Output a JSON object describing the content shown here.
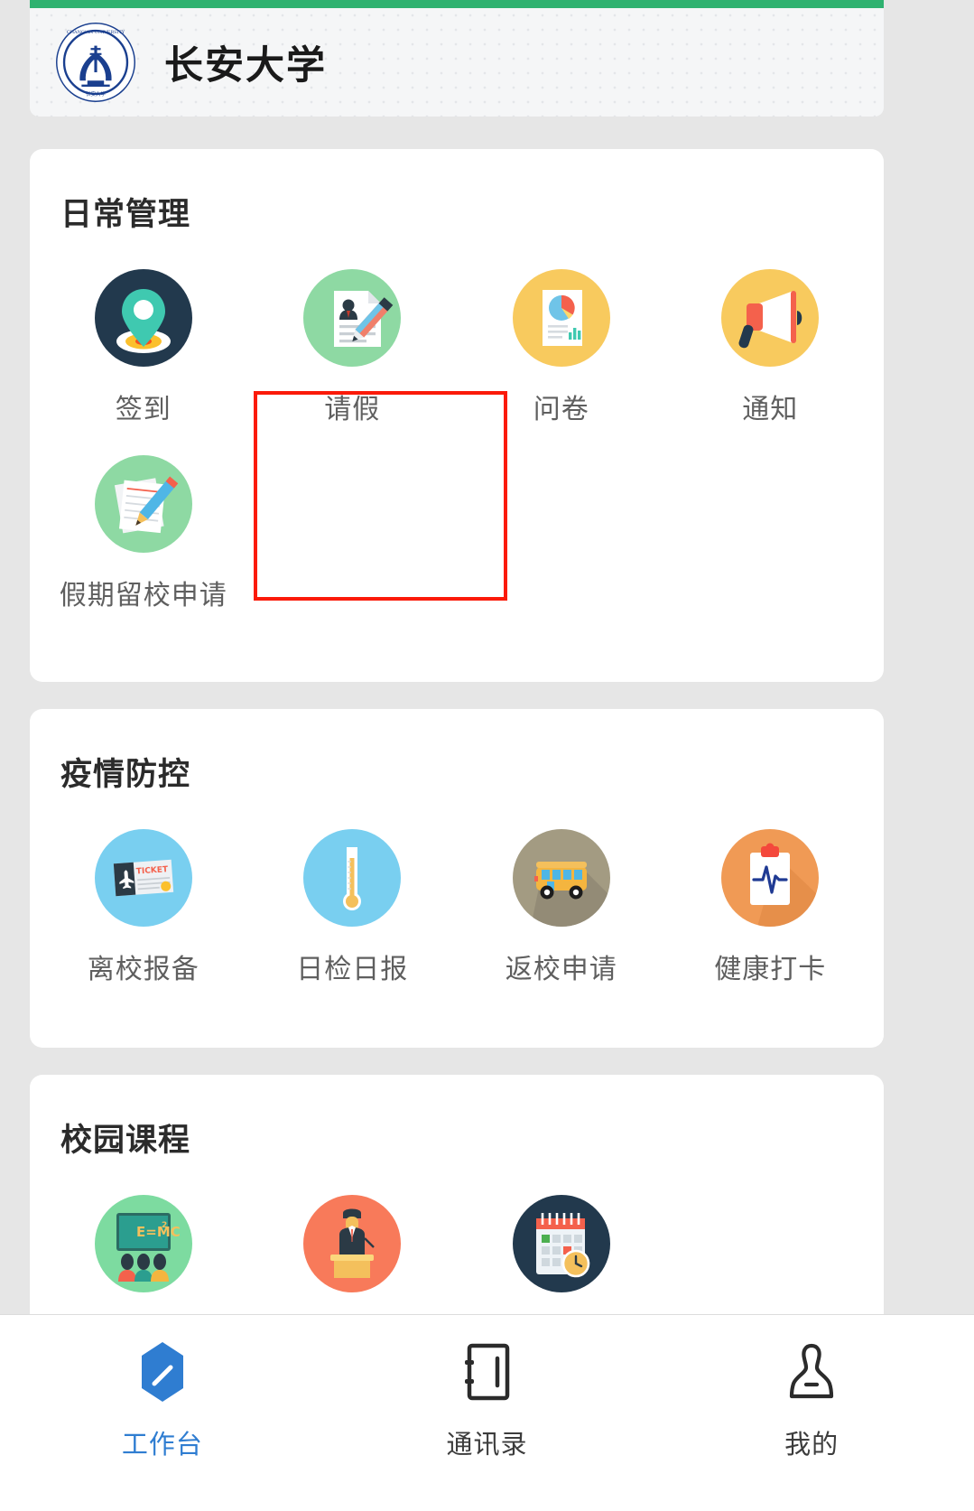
{
  "app": {
    "university_name": "长安大学",
    "logo_text": "CHANG'AN UNIVERSITY",
    "accent_green": "#2fb270",
    "highlight_color": "#fb1a09",
    "active_tab_color": "#2f7dd1"
  },
  "sections": [
    {
      "title": "日常管理",
      "items": [
        {
          "label": "签到",
          "icon": "location-pin-icon",
          "circle_color": "#22394d"
        },
        {
          "label": "请假",
          "icon": "leave-document-icon",
          "circle_color": "#8ed9a3",
          "highlighted": true
        },
        {
          "label": "问卷",
          "icon": "survey-chart-icon",
          "circle_color": "#f8ca5e"
        },
        {
          "label": "通知",
          "icon": "megaphone-icon",
          "circle_color": "#f8ca5e"
        },
        {
          "label": "假期留校申请",
          "icon": "notes-pencil-icon",
          "circle_color": "#8ed9a3"
        }
      ]
    },
    {
      "title": "疫情防控",
      "items": [
        {
          "label": "离校报备",
          "icon": "plane-ticket-icon",
          "circle_color": "#79cff0"
        },
        {
          "label": "日检日报",
          "icon": "thermometer-icon",
          "circle_color": "#79cff0"
        },
        {
          "label": "返校申请",
          "icon": "school-bus-icon",
          "circle_color": "#a39b82"
        },
        {
          "label": "健康打卡",
          "icon": "health-clipboard-icon",
          "circle_color": "#f09a55"
        }
      ]
    },
    {
      "title": "校园课程",
      "items": [
        {
          "label": "",
          "icon": "blackboard-class-icon",
          "circle_color": "#7ddba0"
        },
        {
          "label": "",
          "icon": "lecturer-podium-icon",
          "circle_color": "#f87a5a"
        },
        {
          "label": "",
          "icon": "calendar-clock-icon",
          "circle_color": "#22394d"
        }
      ]
    }
  ],
  "bottom_nav": {
    "items": [
      {
        "label": "工作台",
        "icon": "workbench-icon",
        "active": true
      },
      {
        "label": "通讯录",
        "icon": "contacts-icon",
        "active": false
      },
      {
        "label": "我的",
        "icon": "user-profile-icon",
        "active": false
      }
    ]
  }
}
